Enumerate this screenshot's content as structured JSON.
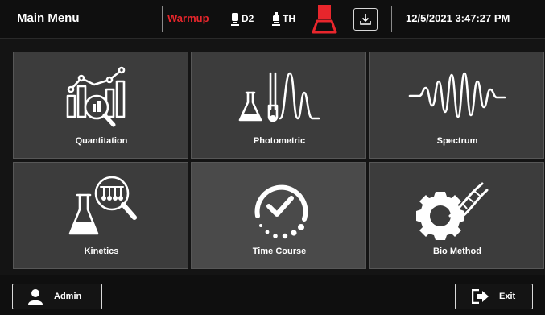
{
  "header": {
    "title": "Main Menu",
    "status": "Warmup",
    "lamp_d2": "D2",
    "lamp_th": "TH",
    "datetime": "12/5/2021 3:47:27 PM"
  },
  "tiles": [
    {
      "label": "Quantitation",
      "icon": "quantitation-icon"
    },
    {
      "label": "Photometric",
      "icon": "photometric-icon"
    },
    {
      "label": "Spectrum",
      "icon": "spectrum-icon"
    },
    {
      "label": "Kinetics",
      "icon": "kinetics-icon"
    },
    {
      "label": "Time Course",
      "icon": "time-course-icon"
    },
    {
      "label": "Bio Method",
      "icon": "bio-method-icon"
    }
  ],
  "footer": {
    "user_label": "Admin",
    "exit_label": "Exit"
  },
  "colors": {
    "status_red": "#e8262c",
    "tile_bg": "#3c3c3c",
    "tile_active_bg": "#4a4a4a",
    "bar_bg": "#0f0f0f"
  }
}
